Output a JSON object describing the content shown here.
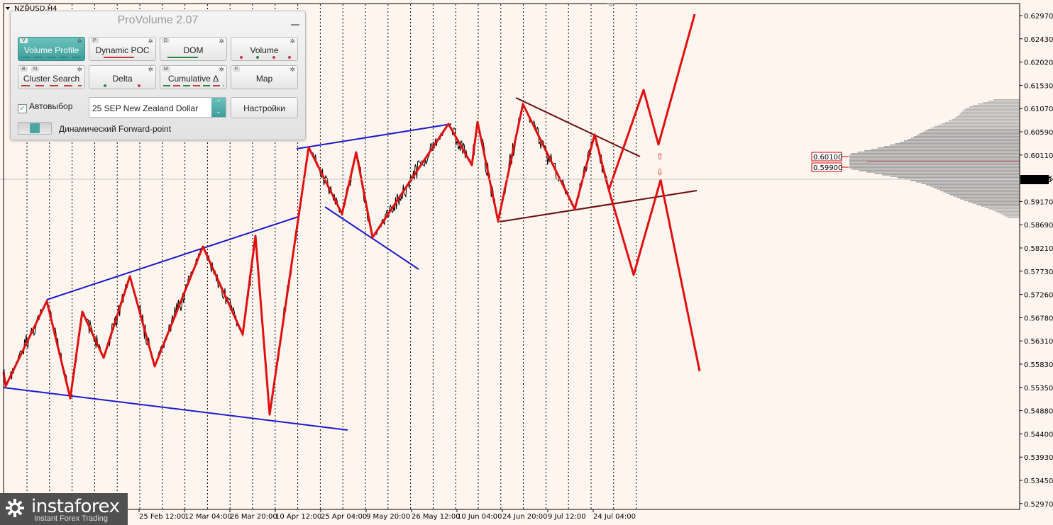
{
  "symbol_label": "NZDUSD,H4",
  "panel": {
    "title": "ProVolume 2.07",
    "buttons": [
      {
        "label": "Volume Profile",
        "tag": "V",
        "active": true
      },
      {
        "label": "Dynamic POC",
        "tag": "P"
      },
      {
        "label": "DOM",
        "tag": "D"
      },
      {
        "label": "Volume",
        "tag": ""
      },
      {
        "label": "Cluster Search",
        "tag": "B",
        "tag2": "N"
      },
      {
        "label": "Delta",
        "tag": ""
      },
      {
        "label": "Cumulative Δ",
        "tag": "M"
      },
      {
        "label": "Map",
        "tag": "F"
      }
    ],
    "autoselect_label": "Автовыбор",
    "autoselect_checked": "✓",
    "instrument_value": "25 SEP New Zealand Dollar",
    "settings_label": "Настройки",
    "forward_point_label": "Динамический Forward-point"
  },
  "price_axis": [
    "0.62970",
    "0.62430",
    "0.62020",
    "0.61530",
    "0.61070",
    "0.60590",
    "0.60110",
    "0.59655",
    "0.59170",
    "0.58690",
    "0.58210",
    "0.57730",
    "0.57260",
    "0.56780",
    "0.56310",
    "0.55830",
    "0.55350",
    "0.54880",
    "0.54400",
    "0.53930",
    "0.53450",
    "0.52970"
  ],
  "current_price": "0.59655",
  "level_labels": [
    "0.60100",
    "0.59900"
  ],
  "date_axis": [
    "25 Feb 12:00",
    "12 Mar 04:00",
    "26 Mar 20:00",
    "10 Apr 12:00",
    "25 Apr 04:00",
    "9 May 20:00",
    "26 May 12:00",
    "10 Jun 04:00",
    "24 Jun 20:00",
    "9 Jul 12:00",
    "24 Jul 04:00"
  ],
  "colors": {
    "zigzag": "#e01010",
    "trend_blue": "#1a1acc",
    "trend_brown": "#6b0d0d",
    "background": "#fff5ef",
    "profile": "#a0a0a0"
  },
  "logo": {
    "brand": "instaforex",
    "sub": "Instant Forex Trading"
  }
}
